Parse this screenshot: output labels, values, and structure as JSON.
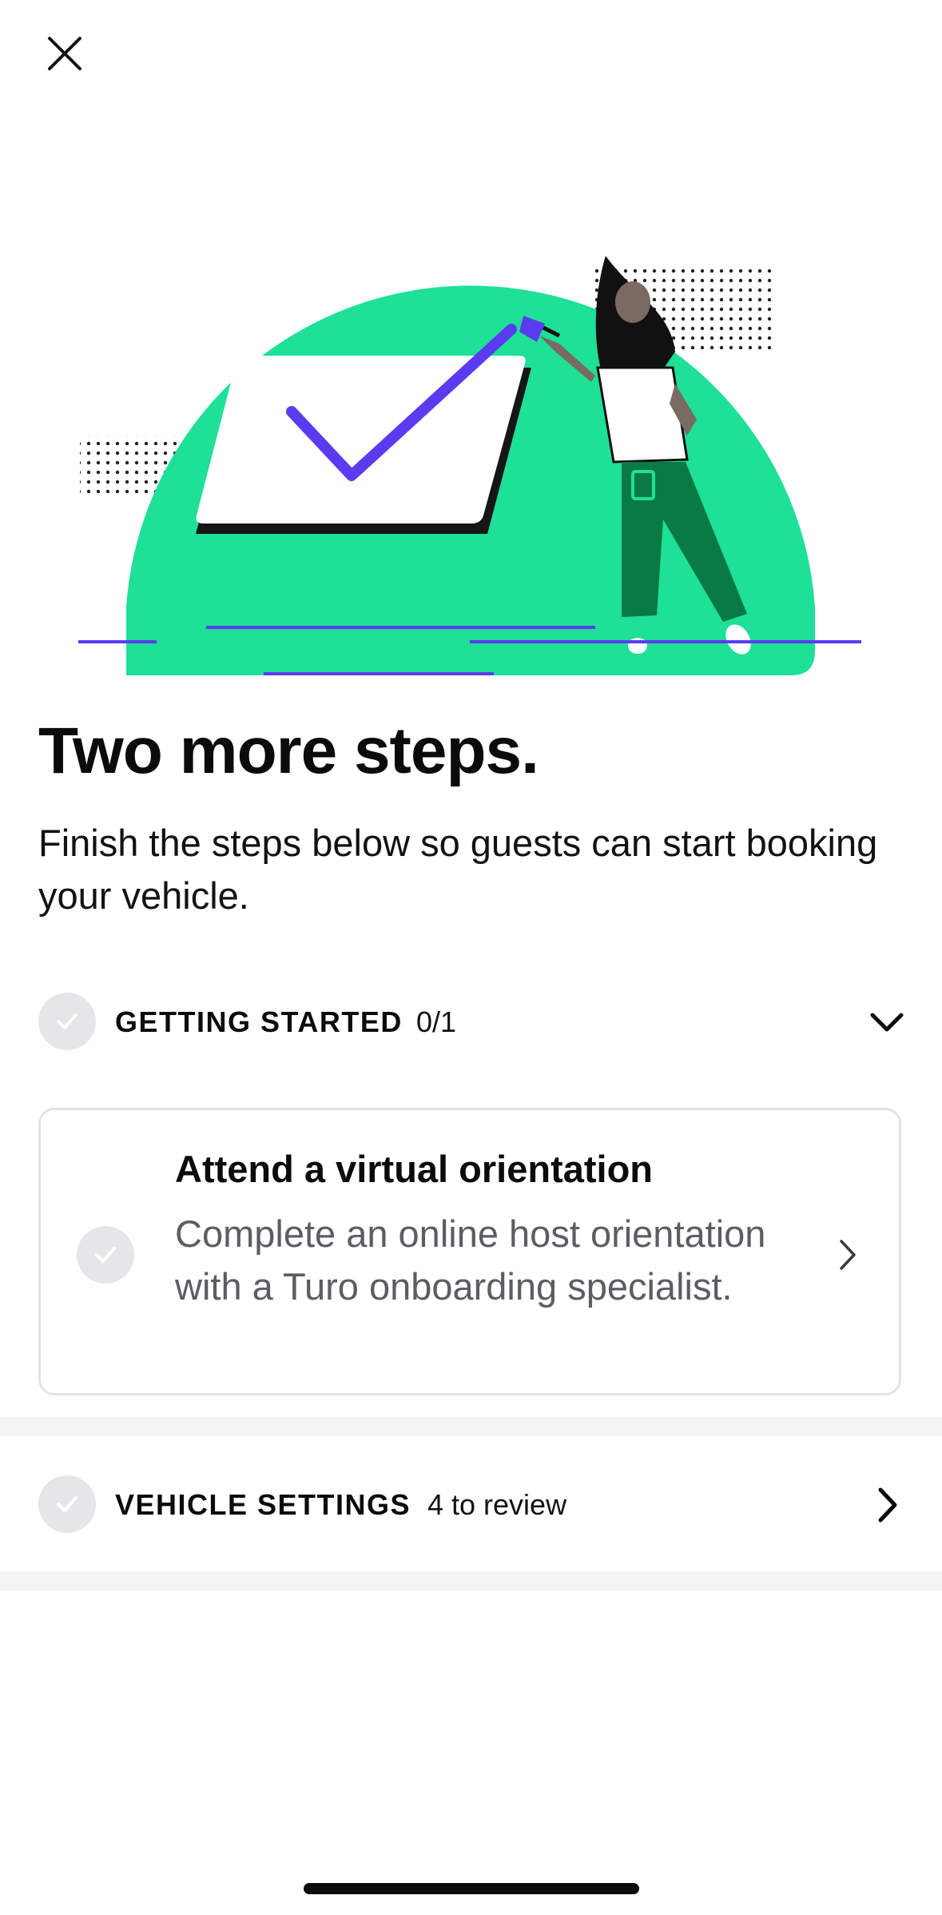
{
  "header": {
    "close_icon": "close-icon"
  },
  "hero": {
    "illustration": "checkmark-painting-illustration",
    "colors": {
      "dome": "#1ee096",
      "accent": "#5b3bf0",
      "pants": "#0a7a45"
    }
  },
  "content": {
    "title": "Two more steps.",
    "subtitle": "Finish the steps below so guests can start booking your vehicle."
  },
  "sections": {
    "getting_started": {
      "title": "GETTING STARTED",
      "count": "0/1",
      "icon": "chevron-down-icon"
    },
    "orientation_card": {
      "title": "Attend a virtual orientation",
      "description": "Complete an online host orientation with a Turo onboarding specialist.",
      "icon": "chevron-right-icon"
    },
    "vehicle_settings": {
      "title": "VEHICLE SETTINGS",
      "count": "4 to review",
      "icon": "chevron-right-icon"
    }
  },
  "colors": {
    "check_circle": "#e6e6e8",
    "text_primary": "#0b0b0d",
    "text_secondary": "#5c5c63",
    "card_border": "#e4e4e7"
  }
}
